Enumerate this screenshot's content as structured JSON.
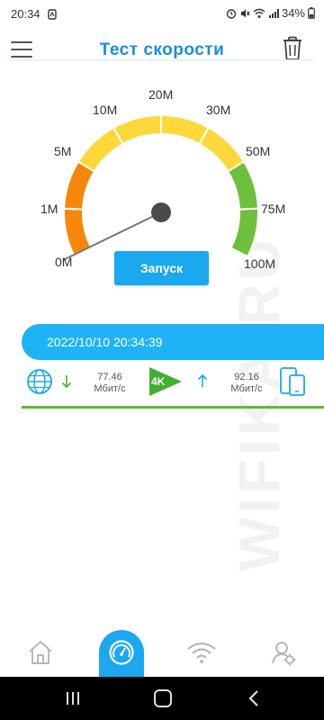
{
  "status_bar": {
    "time": "20:34",
    "battery": "34%"
  },
  "app": {
    "title": "Тест скорости"
  },
  "gauge": {
    "labels": [
      "0M",
      "1M",
      "5M",
      "10M",
      "20M",
      "30M",
      "50M",
      "75M",
      "100M"
    ],
    "colors": {
      "orange": "#f5880c",
      "yellow": "#fcd83a",
      "green": "#6dbf3c"
    }
  },
  "start_button": {
    "label": "Запуск"
  },
  "result": {
    "datetime": "2022/10/10 20:34:39",
    "download": {
      "value": "77.46",
      "unit": "Мбит/с"
    },
    "upload": {
      "value": "92.16",
      "unit": "Мбит/с"
    },
    "badge": "4K"
  },
  "watermark": "WIFIKA.RU",
  "colors": {
    "accent": "#1aa8ee",
    "title": "#1a8fd8",
    "green": "#62b63a"
  }
}
